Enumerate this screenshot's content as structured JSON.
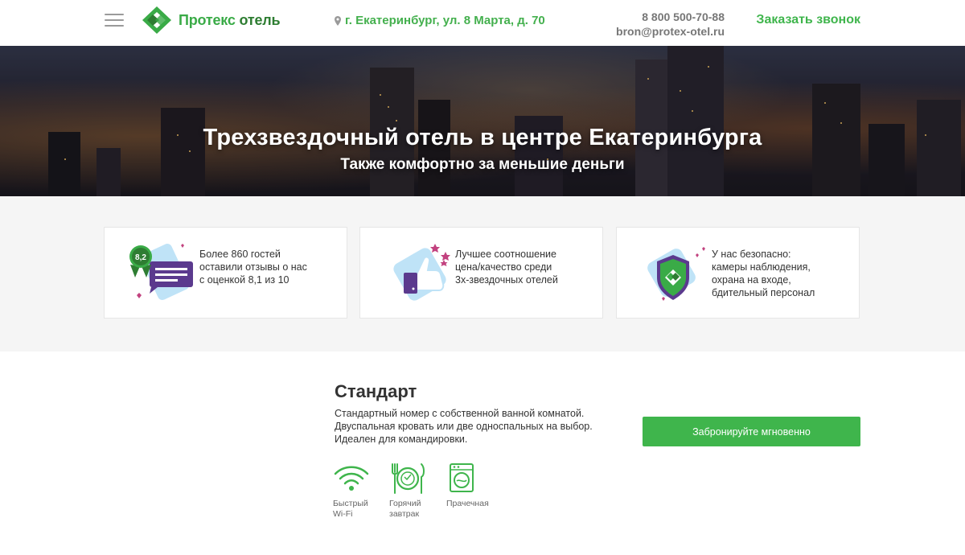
{
  "header": {
    "logo_word1": "Протекс",
    "logo_word2": "отель",
    "address": "г. Екатеринбург, ул. 8 Марта, д. 70",
    "phone": "8 800 500-70-88",
    "email": "bron@protex-otel.ru",
    "callback_label": "Заказать звонок"
  },
  "hero": {
    "title": "Трехзвездочный отель в центре Екатеринбурга",
    "subtitle": "Также комфортно за меньшие деньги"
  },
  "features": [
    {
      "icon": "rating-badge-icon",
      "badge": "8,2",
      "lines": [
        "Более 860 гостей",
        "оставили отзывы о нас",
        "с оценкой 8,1 из 10"
      ]
    },
    {
      "icon": "thumbs-up-icon",
      "lines": [
        "Лучшее соотношение",
        "цена/качество среди",
        "3х-звездочных отелей"
      ]
    },
    {
      "icon": "shield-icon",
      "lines": [
        "У нас безопасно:",
        "камеры наблюдения,",
        "охрана на входе,",
        "бдительный персонал"
      ]
    }
  ],
  "room": {
    "title": "Стандарт",
    "description": [
      "Стандартный номер с собственной ванной комнатой.",
      "Двуспальная кровать или две односпальных на выбор.",
      "Идеален для командировки."
    ],
    "book_label": "Забронируйте мгновенно",
    "amenities": [
      {
        "icon": "wifi-icon",
        "lines": [
          "Быстрый",
          "Wi-Fi"
        ]
      },
      {
        "icon": "breakfast-icon",
        "lines": [
          "Горячий",
          "завтрак"
        ]
      },
      {
        "icon": "laundry-icon",
        "lines": [
          "Прачечная"
        ]
      }
    ]
  },
  "colors": {
    "brand_green": "#3fb54c",
    "dark_green": "#2e7d32",
    "purple": "#5b3a8e",
    "pink": "#c2427f",
    "light_blue": "#bfe3f7"
  }
}
